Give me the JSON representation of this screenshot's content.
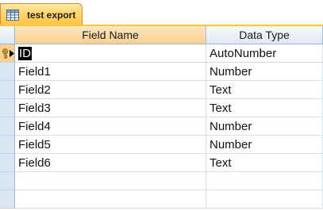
{
  "tab": {
    "label": "test export",
    "icon": "table-icon"
  },
  "grid": {
    "columns": [
      "Field Name",
      "Data Type"
    ],
    "rows": [
      {
        "field_name": "ID",
        "data_type": "AutoNumber",
        "primary_key": true,
        "current": true
      },
      {
        "field_name": "Field1",
        "data_type": "Number"
      },
      {
        "field_name": "Field2",
        "data_type": "Text"
      },
      {
        "field_name": "Field3",
        "data_type": "Text"
      },
      {
        "field_name": "Field4",
        "data_type": "Number"
      },
      {
        "field_name": "Field5",
        "data_type": "Number"
      },
      {
        "field_name": "Field6",
        "data_type": "Text"
      },
      {
        "field_name": "",
        "data_type": ""
      },
      {
        "field_name": "",
        "data_type": ""
      }
    ]
  },
  "colors": {
    "tab_accent": "#ffc33f",
    "header_selected": "#f9cf8f",
    "selector_bg": "#dbe6f4",
    "selection_bg": "#000000"
  }
}
